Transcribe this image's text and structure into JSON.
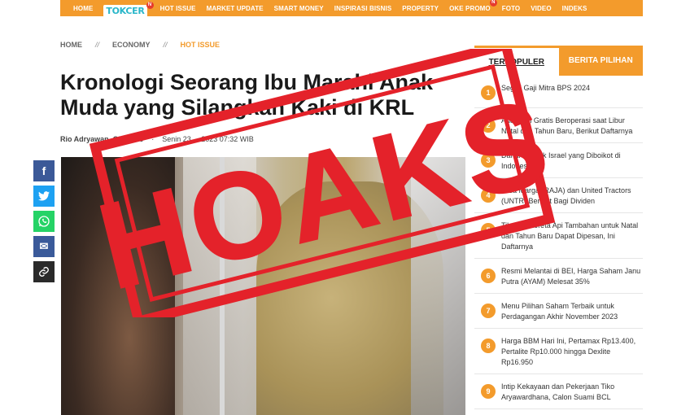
{
  "nav": {
    "home": "HOME",
    "logo": "TOKCER",
    "logo_badge": "N",
    "items": [
      "HOT ISSUE",
      "MARKET UPDATE",
      "SMART MONEY",
      "INSPIRASI BISNIS",
      "PROPERTY"
    ],
    "promo": "OKE PROMO",
    "promo_badge": "N",
    "items_after": [
      "FOTO",
      "VIDEO",
      "INDEKS"
    ]
  },
  "breadcrumb": {
    "home": "HOME",
    "sep": "//",
    "economy": "ECONOMY",
    "current": "HOT ISSUE"
  },
  "article": {
    "title": "Kronologi Seorang Ibu Marahi Anak Muda yang Silangkan Kaki di KRL",
    "author": "Rio Adryawan, Okezone",
    "bullet": "·",
    "date": "Senin 23 ... 2023 07:32 WIB"
  },
  "share": {
    "facebook": "f",
    "twitter": "t",
    "whatsapp": "w",
    "email": "✉",
    "link": "🔗"
  },
  "stamp": {
    "text": "HOAKS",
    "color": "#e4222a"
  },
  "sidebar": {
    "tab_active": "TERPOPULER",
    "tab_other": "BERITA PILIHAN",
    "items": [
      {
        "num": "1",
        "text": "Segini Gaji Mitra BPS 2024"
      },
      {
        "num": "2",
        "text": "Ada 5 Tol Gratis Beroperasi saat Libur Natal dan Tahun Baru, Berikut Daftarnya"
      },
      {
        "num": "3",
        "text": "Daftar Produk Israel yang Diboikot di Indonesia"
      },
      {
        "num": "4",
        "text": "Jasa Marga (RAJA) dan United Tractors (UNTR) Berniat Bagi Dividen"
      },
      {
        "num": "5",
        "text": "Tiket 34 Kereta Api Tambahan untuk Natal dan Tahun Baru Dapat Dipesan, Ini Daftarnya"
      },
      {
        "num": "6",
        "text": "Resmi Melantai di BEI, Harga Saham Janu Putra (AYAM) Melesat 35%"
      },
      {
        "num": "7",
        "text": "Menu Pilihan Saham Terbaik untuk Perdagangan Akhir November 2023"
      },
      {
        "num": "8",
        "text": "Harga BBM Hari Ini, Pertamax Rp13.400, Pertalite Rp10.000 hingga Dexlite Rp16.950"
      },
      {
        "num": "9",
        "text": "Intip Kekayaan dan Pekerjaan Tiko Aryawardhana, Calon Suami BCL"
      }
    ]
  },
  "colors": {
    "accent": "#f39b2c",
    "stamp_red": "#e4222a"
  }
}
